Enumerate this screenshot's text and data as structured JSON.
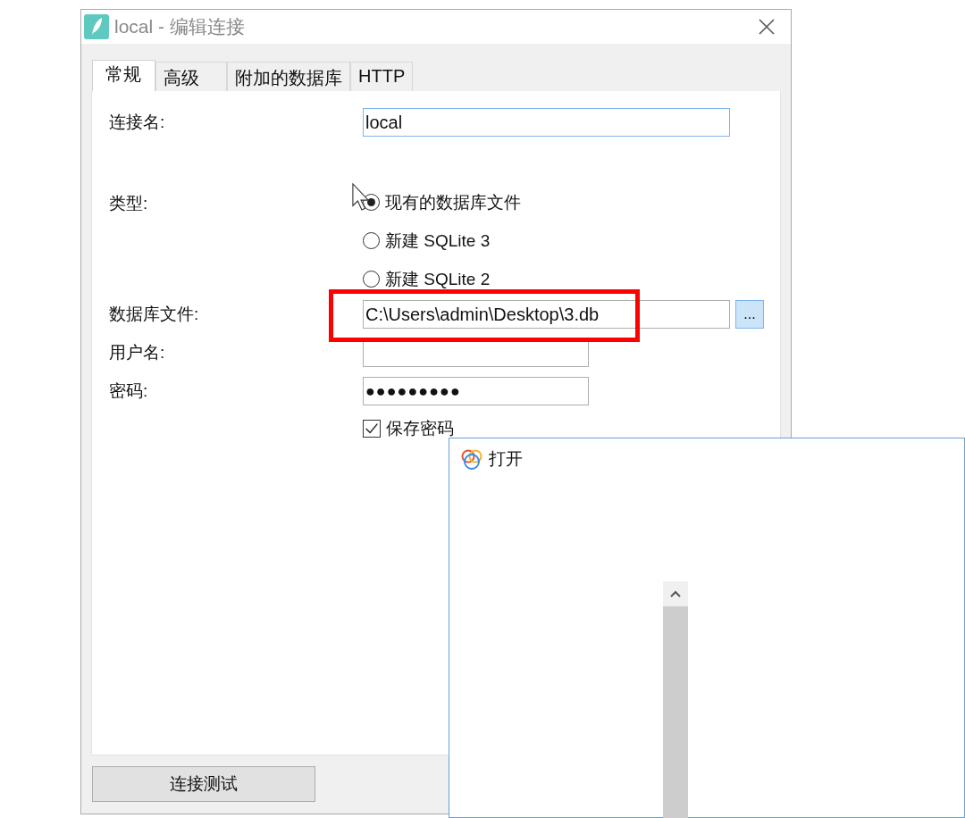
{
  "window": {
    "title": "local - 编辑连接"
  },
  "tabs": [
    {
      "label": "常规",
      "selected": true
    },
    {
      "label": "高级",
      "selected": false
    },
    {
      "label": "附加的数据库",
      "selected": false
    },
    {
      "label": "HTTP",
      "selected": false
    }
  ],
  "form": {
    "connection_name": {
      "label": "连接名:",
      "value": "local"
    },
    "type": {
      "label": "类型:",
      "options": [
        {
          "label": "现有的数据库文件",
          "selected": true
        },
        {
          "label": "新建 SQLite 3",
          "selected": false
        },
        {
          "label": "新建 SQLite 2",
          "selected": false
        }
      ]
    },
    "database_file": {
      "label": "数据库文件:",
      "value": "C:\\Users\\admin\\Desktop\\3.db",
      "browse_label": "..."
    },
    "username": {
      "label": "用户名:"
    },
    "password": {
      "label": "密码:",
      "value": "●●●●●●●●●"
    },
    "save_password": {
      "label": "保存密码",
      "checked": true
    }
  },
  "buttons": [
    {
      "label": "连接测试"
    }
  ],
  "open_dialog": {
    "title": "打开"
  }
}
